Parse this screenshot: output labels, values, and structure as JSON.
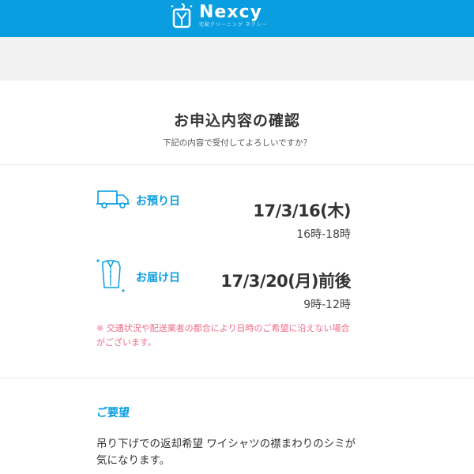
{
  "header": {
    "brand": "Nexcy",
    "tagline": "宅配クリーニング ネクシー"
  },
  "confirm": {
    "title": "お申込内容の確認",
    "subtitle": "下記の内容で受付してよろしいですか？"
  },
  "pickup": {
    "label": "お預り日",
    "date": "17/3/16(木)",
    "time": "16時-18時",
    "icon": "truck-icon"
  },
  "delivery": {
    "label": "お届け日",
    "date": "17/3/20(月)前後",
    "time": "9時-12時",
    "icon": "shirt-icon"
  },
  "note": "※ 交通状況や配送業者の都合により日時のご希望に沿えない場合がございます。",
  "request": {
    "label": "ご要望",
    "text": "吊り下げでの返却希望 ワイシャツの襟まわりのシミが気になります。"
  },
  "colors": {
    "brand_blue": "#0a9ee0",
    "note_pink": "#ef6b8a"
  }
}
